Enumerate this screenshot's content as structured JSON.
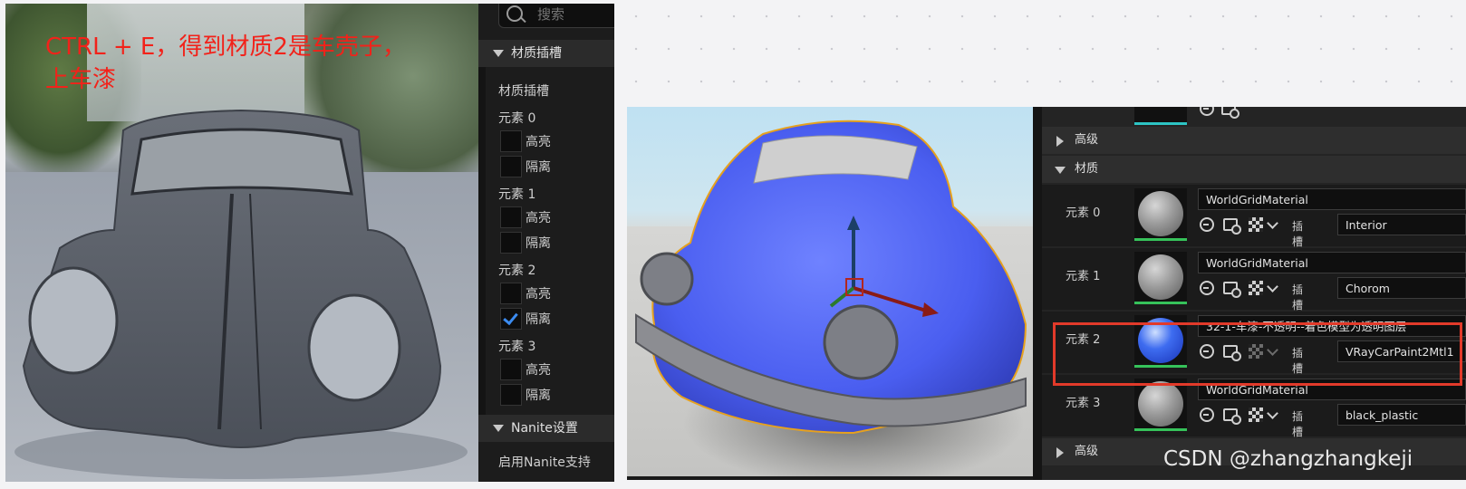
{
  "annotation": {
    "line1": "CTRL + E，得到材质2是车壳子，",
    "line2": "上车漆"
  },
  "left_panel": {
    "search_placeholder": "搜索",
    "section_slots": "材质插槽",
    "slots_label": "材质插槽",
    "elements": [
      {
        "name": "元素 0",
        "highlight_label": "高亮",
        "highlight_checked": false,
        "isolate_label": "隔离",
        "isolate_checked": false
      },
      {
        "name": "元素 1",
        "highlight_label": "高亮",
        "highlight_checked": false,
        "isolate_label": "隔离",
        "isolate_checked": false
      },
      {
        "name": "元素 2",
        "highlight_label": "高亮",
        "highlight_checked": false,
        "isolate_label": "隔离",
        "isolate_checked": true
      },
      {
        "name": "元素 3",
        "highlight_label": "高亮",
        "highlight_checked": false,
        "isolate_label": "隔离",
        "isolate_checked": false
      }
    ],
    "section_nanite": "Nanite设置",
    "nanite_enable": "启用Nanite支持"
  },
  "right_panel": {
    "advanced_top": "高级",
    "section_material": "材质",
    "slot_word": "插槽",
    "elements": [
      {
        "name": "元素 0",
        "material": "WorldGridMaterial",
        "slot": "Interior"
      },
      {
        "name": "元素 1",
        "material": "WorldGridMaterial",
        "slot": "Chorom"
      },
      {
        "name": "元素 2",
        "material": "32-1-车漆-不透明--着色模型为透明图层",
        "slot": "VRayCarPaint2Mtl1"
      },
      {
        "name": "元素 3",
        "material": "WorldGridMaterial",
        "slot": "black_plastic"
      }
    ],
    "advanced_bottom": "高级"
  },
  "watermark": "CSDN @zhangzhangkeji",
  "colors": {
    "annotation": "#f2221a",
    "highlight_box": "#e23a2a",
    "check_blue": "#3b8bf0",
    "thumb_bar_green": "#36c25a",
    "car_paint_blue": "#4a5ef0",
    "selection_outline": "#e6a11e"
  }
}
